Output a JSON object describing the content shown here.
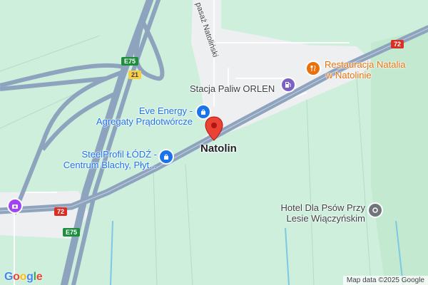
{
  "map": {
    "town_label": "Natolin",
    "street_label": "pasaż Natoliński",
    "pois": [
      {
        "id": "orlen",
        "lines": [
          "Stacja Paliw ORLEN"
        ],
        "category": "fuel-icon",
        "color": "#7b61c4"
      },
      {
        "id": "eve",
        "lines": [
          "Eve Energy -",
          "Agregaty Prądotwórcze"
        ],
        "category": "shopping-bag-icon",
        "color": "#1a73e8"
      },
      {
        "id": "steelprofil",
        "lines": [
          "SteelProfil ŁÓDŹ -",
          "Centrum Blachy, Płyt..."
        ],
        "category": "shopping-bag-icon",
        "color": "#1a73e8"
      },
      {
        "id": "restauracja",
        "lines": [
          "Restauracja Natalia",
          "w Natolinie"
        ],
        "category": "restaurant-icon",
        "color": "#e8710a"
      },
      {
        "id": "hotel",
        "lines": [
          "Hotel Dla Psów Przy",
          "Lesie Wiączyńskim"
        ],
        "category": "place-icon",
        "color": "#70757a"
      }
    ],
    "road_shields": [
      {
        "id": "e75-top",
        "text": "E75",
        "color": "#1e8e3e"
      },
      {
        "id": "21",
        "text": "21",
        "color": "#f9ce45"
      },
      {
        "id": "72-right",
        "text": "72",
        "color": "#d93025"
      },
      {
        "id": "72-left",
        "text": "72",
        "color": "#d93025"
      },
      {
        "id": "e75-bottom",
        "text": "E75",
        "color": "#1e8e3e"
      }
    ],
    "pin_color": "#ea4335",
    "attribution": "Map data ©2025 Google",
    "logo": [
      "G",
      "o",
      "o",
      "g",
      "l",
      "e"
    ],
    "logo_colors": [
      "#4285f4",
      "#ea4335",
      "#fbbc05",
      "#4285f4",
      "#34a853",
      "#ea4335"
    ],
    "base_color": "#cdefdc",
    "road_color": "#8ea3bd",
    "built_color": "#eeeff1"
  }
}
